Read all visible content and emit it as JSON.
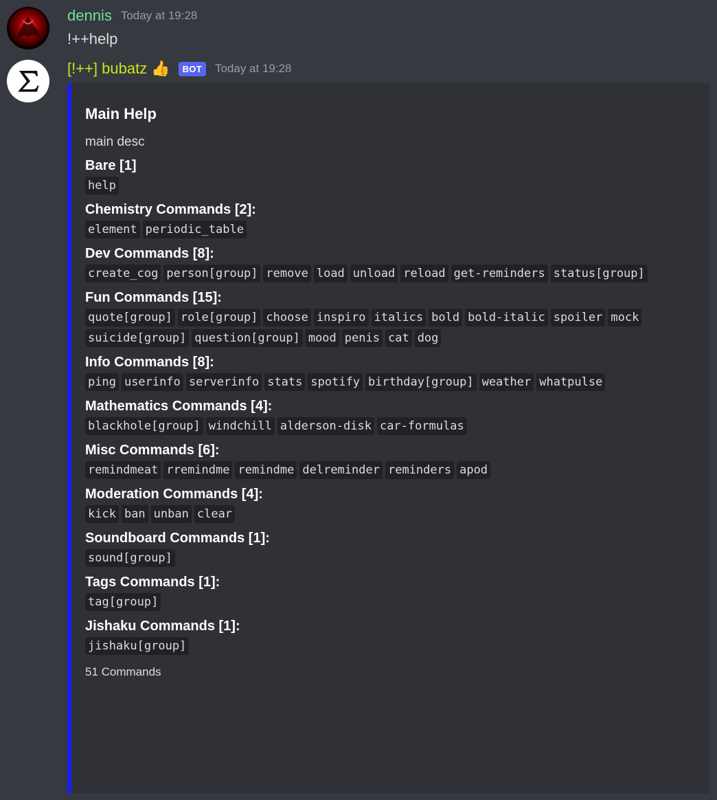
{
  "messages": [
    {
      "username": "dennis",
      "timestamp": "Today at 19:28",
      "content": "!++help"
    },
    {
      "username": "[!++] bubatz",
      "emoji": "👍",
      "badge": "BOT",
      "timestamp": "Today at 19:28"
    }
  ],
  "embed": {
    "accent_color": "#1c1cff",
    "title": "Main Help",
    "description": "main desc",
    "fields": [
      {
        "name": "Bare [1]",
        "commands": [
          "help"
        ]
      },
      {
        "name": "Chemistry Commands [2]:",
        "commands": [
          "element",
          "periodic_table"
        ]
      },
      {
        "name": "Dev Commands [8]:",
        "commands": [
          "create_cog",
          "person[group]",
          "remove",
          "load",
          "unload",
          "reload",
          "get-reminders",
          "status[group]"
        ]
      },
      {
        "name": "Fun Commands [15]:",
        "commands": [
          "quote[group]",
          "role[group]",
          "choose",
          "inspiro",
          "italics",
          "bold",
          "bold-italic",
          "spoiler",
          "mock",
          "suicide[group]",
          "question[group]",
          "mood",
          "penis",
          "cat",
          "dog"
        ]
      },
      {
        "name": "Info Commands [8]:",
        "commands": [
          "ping",
          "userinfo",
          "serverinfo",
          "stats",
          "spotify",
          "birthday[group]",
          "weather",
          "whatpulse"
        ]
      },
      {
        "name": "Mathematics Commands [4]:",
        "commands": [
          "blackhole[group]",
          "windchill",
          "alderson-disk",
          "car-formulas"
        ]
      },
      {
        "name": "Misc Commands [6]:",
        "commands": [
          "remindmeat",
          "rremindme",
          "remindme",
          "delreminder",
          "reminders",
          "apod"
        ]
      },
      {
        "name": "Moderation Commands [4]:",
        "commands": [
          "kick",
          "ban",
          "unban",
          "clear"
        ]
      },
      {
        "name": "Soundboard Commands [1]:",
        "commands": [
          "sound[group]"
        ]
      },
      {
        "name": "Tags Commands [1]:",
        "commands": [
          "tag[group]"
        ]
      },
      {
        "name": "Jishaku Commands [1]:",
        "commands": [
          "jishaku[group]"
        ]
      }
    ],
    "footer": "51 Commands"
  }
}
